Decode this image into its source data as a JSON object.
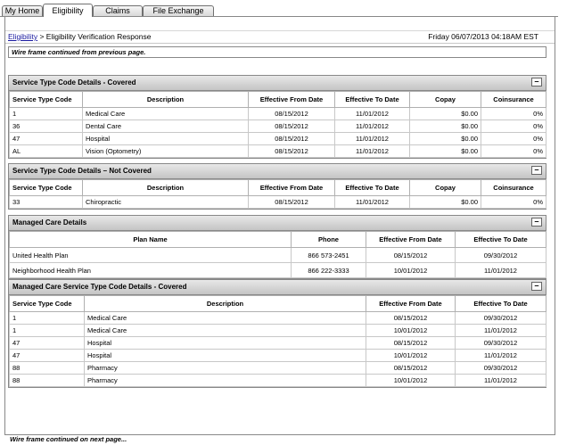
{
  "tabs": [
    "My Home",
    "Eligibility",
    "Claims",
    "File Exchange"
  ],
  "breadcrumb": {
    "link": "Eligibility",
    "separator": ">",
    "current": "Eligibility Verification Response"
  },
  "datetime": "Friday 06/07/2013 04:18AM EST",
  "wire_top": "Wire frame continued from previous page.",
  "wire_bottom": "Wire frame continued on next page...",
  "covered": {
    "title": "Service Type Code Details - Covered",
    "headers": [
      "Service Type Code",
      "Description",
      "Effective From Date",
      "Effective To Date",
      "Copay",
      "Coinsurance"
    ],
    "rows": [
      [
        "1",
        "Medical Care",
        "08/15/2012",
        "11/01/2012",
        "$0.00",
        "0%"
      ],
      [
        "36",
        "Dental Care",
        "08/15/2012",
        "11/01/2012",
        "$0.00",
        "0%"
      ],
      [
        "47",
        "Hospital",
        "08/15/2012",
        "11/01/2012",
        "$0.00",
        "0%"
      ],
      [
        "AL",
        "Vision (Optometry)",
        "08/15/2012",
        "11/01/2012",
        "$0.00",
        "0%"
      ]
    ]
  },
  "not_covered": {
    "title": "Service Type Code Details – Not Covered",
    "headers": [
      "Service Type Code",
      "Description",
      "Effective From Date",
      "Effective To Date",
      "Copay",
      "Coinsurance"
    ],
    "rows": [
      [
        "33",
        "Chiropractic",
        "08/15/2012",
        "11/01/2012",
        "$0.00",
        "0%"
      ]
    ]
  },
  "managed_care": {
    "title": "Managed Care Details",
    "headers": [
      "Plan Name",
      "Phone",
      "Effective From Date",
      "Effective To Date"
    ],
    "rows": [
      [
        "United Health Plan",
        "866 573-2451",
        "08/15/2012",
        "09/30/2012"
      ],
      [
        "Neighborhood Health Plan",
        "866 222-3333",
        "10/01/2012",
        "11/01/2012"
      ]
    ]
  },
  "mc_service": {
    "title": "Managed Care Service Type Code Details - Covered",
    "headers": [
      "Service Type Code",
      "Description",
      "Effective From Date",
      "Effective To Date"
    ],
    "rows": [
      [
        "1",
        "Medical Care",
        "08/15/2012",
        "09/30/2012"
      ],
      [
        "1",
        "Medical Care",
        "10/01/2012",
        "11/01/2012"
      ],
      [
        "47",
        "Hospital",
        "08/15/2012",
        "09/30/2012"
      ],
      [
        "47",
        "Hospital",
        "10/01/2012",
        "11/01/2012"
      ],
      [
        "88",
        "Pharmacy",
        "08/15/2012",
        "09/30/2012"
      ],
      [
        "88",
        "Pharmacy",
        "10/01/2012",
        "11/01/2012"
      ]
    ]
  },
  "collapse_symbol": "–"
}
